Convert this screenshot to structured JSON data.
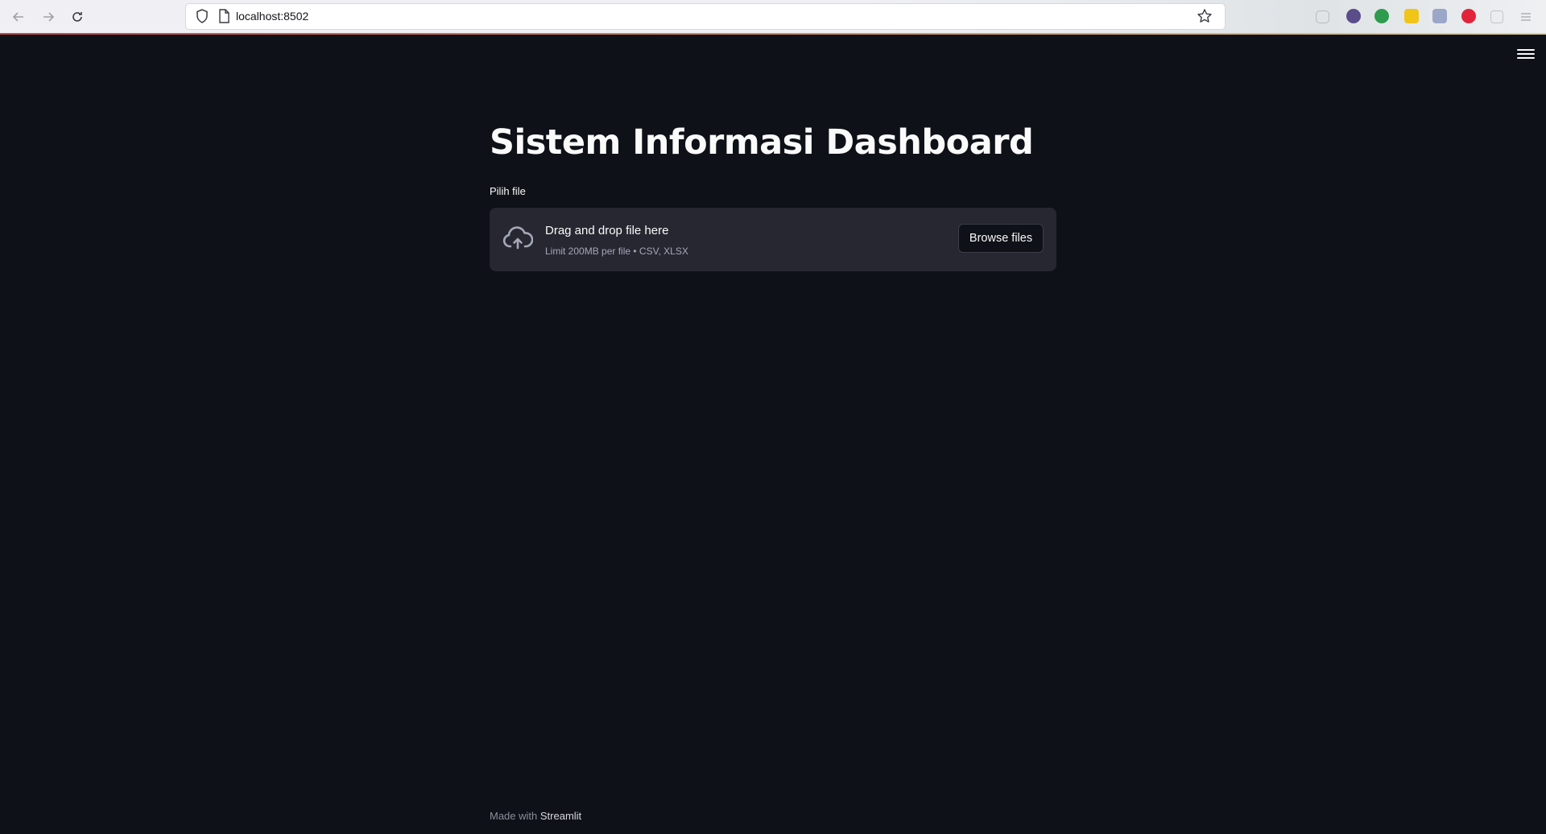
{
  "browser": {
    "url": "localhost:8502"
  },
  "page": {
    "title": "Sistem Informasi Dashboard",
    "uploader": {
      "label": "Pilih file",
      "drop_text": "Drag and drop file here",
      "limit_text": "Limit 200MB per file • CSV, XLSX",
      "browse_label": "Browse files"
    },
    "footer": {
      "prefix": "Made with",
      "brand": "Streamlit"
    }
  },
  "colors": {
    "background": "#0e1117",
    "dropzone": "#262730",
    "text": "#fafafa"
  }
}
